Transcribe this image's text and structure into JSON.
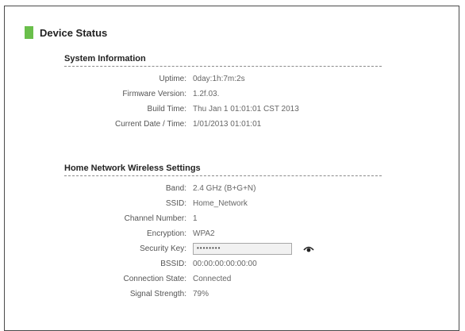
{
  "page": {
    "title": "Device Status"
  },
  "system_information": {
    "heading": "System Information",
    "rows": [
      {
        "label": "Uptime:",
        "value": "0day:1h:7m:2s"
      },
      {
        "label": "Firmware Version:",
        "value": "1.2f.03."
      },
      {
        "label": "Build Time:",
        "value": "Thu Jan 1 01:01:01 CST 2013"
      },
      {
        "label": "Current Date / Time:",
        "value": "1/01/2013 01:01:01"
      }
    ]
  },
  "wireless": {
    "heading": "Home Network Wireless Settings",
    "band_label": "Band:",
    "band_value": "2.4 GHz (B+G+N)",
    "ssid_label": "SSID:",
    "ssid_value": "Home_Network",
    "channel_label": "Channel Number:",
    "channel_value": "1",
    "encryption_label": "Encryption:",
    "encryption_value": "WPA2",
    "security_key_label": "Security Key:",
    "security_key_value": "••••••••",
    "bssid_label": "BSSID:",
    "bssid_value": "00:00:00:00:00:00",
    "connection_label": "Connection State:",
    "connection_value": "Connected",
    "signal_label": "Signal Strength:",
    "signal_value": "79%"
  },
  "icons": {
    "show_key": "eye-icon"
  },
  "colors": {
    "accent": "#6abf4b"
  }
}
